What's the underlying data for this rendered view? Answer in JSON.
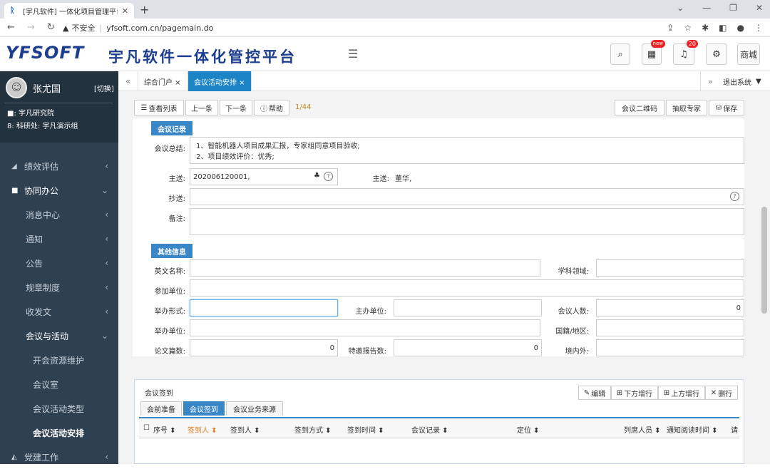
{
  "browser": {
    "tab_title": "[宇凡软件] 一体化项目管理平台",
    "address_warning": "不安全",
    "address_url": "yfsoft.com.cn/pagemain.do"
  },
  "header": {
    "logo_text": "YFSOFT",
    "system_title": "宇凡软件一体化管控平台",
    "new_badge": "new",
    "notify_count": "20",
    "mall_label": "商城"
  },
  "sidebar": {
    "user_name": "张尤国",
    "switch_label": "[切换]",
    "org_line1": "宇凡研究院",
    "org_line2": "科研处: 宇凡演示组",
    "org_line1_prefix": "■:",
    "org_line2_prefix": "8:",
    "items": [
      {
        "label": "绩效评估"
      },
      {
        "label": "协同办公"
      },
      {
        "label": "消息中心"
      },
      {
        "label": "通知"
      },
      {
        "label": "公告"
      },
      {
        "label": "规章制度"
      },
      {
        "label": "收发文"
      },
      {
        "label": "会议与活动"
      },
      {
        "label": "开会资源维护"
      },
      {
        "label": "会议室"
      },
      {
        "label": "会议活动类型"
      },
      {
        "label": "会议活动安排"
      },
      {
        "label": "党建工作"
      }
    ]
  },
  "tabs": {
    "items": [
      {
        "label": "综合门户 ×"
      },
      {
        "label": "会议活动安排 ×"
      }
    ],
    "logout": "退出系统"
  },
  "toolbar": {
    "view_list": "查看列表",
    "prev": "上一条",
    "next": "下一条",
    "help": "帮助",
    "pager": "1/44",
    "qrcode": "会议二维码",
    "pick_expert": "抽取专家",
    "save": "保存"
  },
  "form": {
    "section_record": "会议记录",
    "summary_label": "会议总结:",
    "summary_line1": "1、智能机器人项目成果汇报，专家组同意项目验收;",
    "summary_line2": "2、项目绩效评价：优秀;",
    "main_send_label": "主送:",
    "main_send_value": "202006120001,",
    "main_send_label2": "主送:",
    "main_send_value2": "董华,",
    "cc_label": "抄送:",
    "remark_label": "备注:",
    "section_other": "其他信息",
    "en_name_label": "英文名称:",
    "field_label": "学科领域:",
    "participant_label": "参加单位:",
    "form_label": "举办形式:",
    "host_label": "主办单位:",
    "count_label": "会议人数:",
    "count_value": "0",
    "organizer_label": "举办单位:",
    "country_label": "国籍/地区:",
    "paper_label": "论文篇数:",
    "paper_value": "0",
    "invited_label": "特邀报告数:",
    "invited_value": "0",
    "domestic_label": "境内外:"
  },
  "sign": {
    "title": "会议签到",
    "edit": "编辑",
    "add_below": "下方增行",
    "add_above": "上方增行",
    "delete": "删行",
    "tabs": [
      "会前准备",
      "会议签到",
      "会议业务来源"
    ],
    "columns": [
      "序号",
      "签到人",
      "签到人",
      "签到方式",
      "签到时间",
      "会议记录",
      "定位",
      "列席人员",
      "通知阅读时间",
      "请"
    ]
  }
}
